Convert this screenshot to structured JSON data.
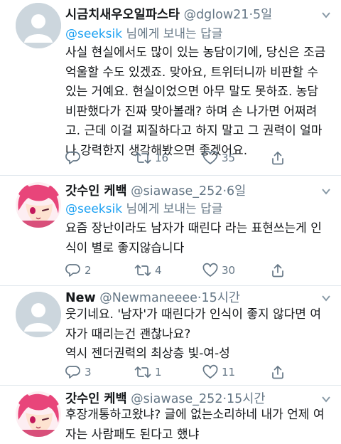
{
  "reply_prefix": "님에게 보내는 답글",
  "tweets": [
    {
      "name": "시금치새우오일파스타",
      "handle": "@dglow21",
      "time": "5일",
      "avatar": "default-avatar",
      "reply_to": "@seeksik",
      "lines": [
        "사실 현실에서도 많이 있는 농담이기에, 당신은 조금",
        "억울할 수도 있겠죠. 맞아요, 트위터니까 비판할 수",
        "있는 거예요. 현실이었으면 아무 말도 못하죠. 농담",
        "비판했다가 진짜 맞아볼래? 하며 손 나가면 어쩌려",
        "고. 근데 이걸 찌질하다고 하지 말고 그 권력이 얼마",
        "나 강력한지 생각해봤으면 좋겠어요."
      ],
      "replies": "",
      "retweets": "16",
      "likes": "35"
    },
    {
      "name": "갓수인 케백",
      "handle": "@siawase_252",
      "time": "6일",
      "avatar": "anime-avatar",
      "reply_to": "@seeksik",
      "lines": [
        "요즘 장난이라도 남자가 때린다 라는 표현쓰는게 인",
        "식이 별로 좋지않습니다"
      ],
      "replies": "2",
      "retweets": "4",
      "likes": "30"
    },
    {
      "name": "New",
      "handle": "@Newmaneeee",
      "time": "15시간",
      "avatar": "default-avatar",
      "reply_to": "",
      "lines": [
        "웃기네요. '남자'가 때린다가 인식이 좋지 않다면 여",
        "자가 때리는건 괜찮나요?",
        "역시 젠더권력의 최상층 빛-여-성"
      ],
      "replies": "3",
      "retweets": "1",
      "likes": "11"
    },
    {
      "name": "갓수인 케백",
      "handle": "@siawase_252",
      "time": "15시간",
      "avatar": "anime-avatar",
      "reply_to": "",
      "lines": [
        "후장개통하고왔냐? 글에 없는소리하네 내가 언제 여",
        "자는 사람패도 된다고 했냐"
      ],
      "replies": "",
      "retweets": "",
      "likes": ""
    }
  ]
}
